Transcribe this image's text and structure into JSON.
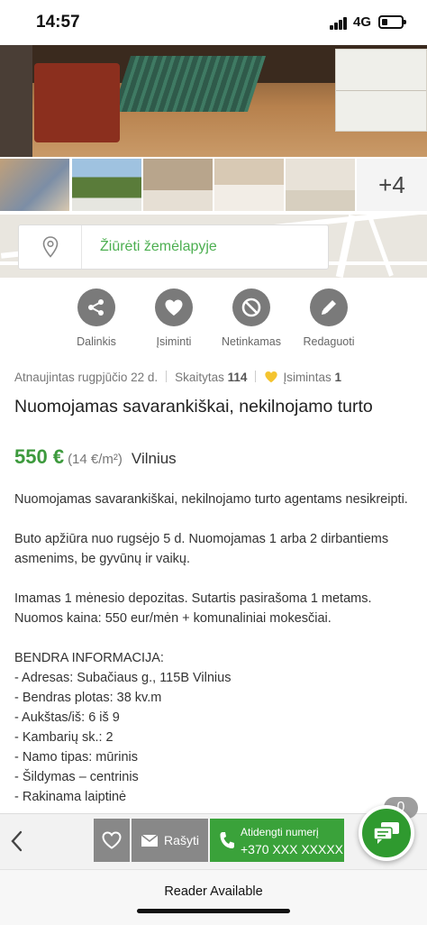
{
  "status_bar": {
    "time": "14:57",
    "network": "4G",
    "battery_level": 0.3
  },
  "gallery": {
    "more_count": "+4"
  },
  "map": {
    "label": "Žiūrėti žemėlapyje",
    "icon": "map-pin-icon"
  },
  "actions": [
    {
      "label": "Dalinkis",
      "icon": "share-icon"
    },
    {
      "label": "Įsiminti",
      "icon": "heart-icon"
    },
    {
      "label": "Netinkamas",
      "icon": "block-icon"
    },
    {
      "label": "Redaguoti",
      "icon": "pencil-icon"
    }
  ],
  "meta": {
    "updated": "Atnaujintas rugpjūčio 22 d.",
    "views_label": "Skaitytas",
    "views": "114",
    "saved_label": "Įsimintas",
    "saved": "1"
  },
  "listing": {
    "title": "Nuomojamas savarankiškai, nekilnojamo turto",
    "price": "550 €",
    "price_per_sqm": "(14 €/m²)",
    "city": "Vilnius",
    "description": "Nuomojamas savarankiškai, nekilnojamo turto agentams nesikreipti.\n\nButo apžiūra nuo rugsėjo 5 d. Nuomojamas 1 arba 2 dirbantiems asmenims, be gyvūnų ir vaikų.\n\nImamas 1 mėnesio depozitas. Sutartis pasirašoma 1 metams. Nuomos kaina: 550 eur/mėn + komunaliniai mokesčiai.\n\nBENDRA INFORMACIJA:\n- Adresas: Subačiaus g., 115B Vilnius\n- Bendras plotas: 38 kv.m\n- Aukštas/iš: 6 iš 9\n- Kambarių sk.: 2\n- Namo tipas: mūrinis\n- Šildymas – centrinis\n- Rakinama laiptinė"
  },
  "bottom_bar": {
    "write_label": "Rašyti",
    "call_line1": "Atidengti numerį",
    "call_line2": "+370 XXX XXXXX",
    "chat_count": "0"
  },
  "reader": {
    "label": "Reader Available"
  },
  "colors": {
    "accent_green": "#3aa23a",
    "price_green": "#3d9a3d",
    "icon_gray": "#7a7a7a"
  }
}
